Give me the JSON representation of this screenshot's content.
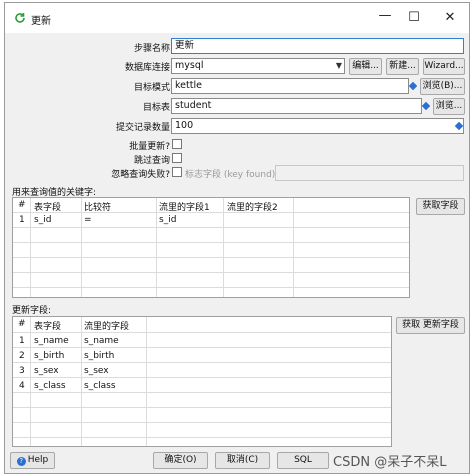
{
  "window": {
    "title": "更新",
    "minimize_glyph": "—",
    "maximize_glyph": "☐",
    "close_glyph": "✕"
  },
  "form": {
    "step_name_label": "步骤名称",
    "step_name_value": "更新",
    "connection_label": "数据库连接",
    "connection_value": "mysql",
    "edit_button": "编辑...",
    "new_button": "新建...",
    "wizard_button": "Wizard...",
    "target_schema_label": "目标模式",
    "target_schema_value": "kettle",
    "browse_schema_button": "浏览(B)...",
    "target_table_label": "目标表",
    "target_table_value": "student",
    "browse_table_button": "浏览...",
    "commit_size_label": "提交记录数量",
    "commit_size_value": "100",
    "batch_update_label": "批量更新?",
    "skip_lookup_label": "跳过查询",
    "ignore_lookup_failure_label": "忽略查询失败?",
    "flag_field_label": "标志字段 (key found)",
    "flag_field_value": ""
  },
  "keys_section": {
    "label": "用来查询值的关键字:",
    "get_fields_button": "获取字段",
    "columns": [
      "#",
      "表字段",
      "比较符",
      "流里的字段1",
      "流里的字段2"
    ],
    "rows": [
      {
        "num": "1",
        "table_field": "s_id",
        "comparator": "=",
        "stream_field1": "s_id",
        "stream_field2": ""
      }
    ]
  },
  "update_section": {
    "label": "更新字段:",
    "get_update_fields_button": "获取 更新字段",
    "columns": [
      "#",
      "表字段",
      "流里的字段"
    ],
    "rows": [
      {
        "num": "1",
        "table_field": "s_name",
        "stream_field": "s_name"
      },
      {
        "num": "2",
        "table_field": "s_birth",
        "stream_field": "s_birth"
      },
      {
        "num": "3",
        "table_field": "s_sex",
        "stream_field": "s_sex"
      },
      {
        "num": "4",
        "table_field": "s_class",
        "stream_field": "s_class"
      }
    ]
  },
  "footer": {
    "help_button": "Help",
    "ok_button": "确定(O)",
    "cancel_button": "取消(C)",
    "sql_button": "SQL"
  },
  "watermark": "CSDN @呆子不呆L",
  "colors": {
    "accent": "#2a6fd1",
    "focus_border": "#2f7fd6",
    "dialog_bg": "#f0f0f0"
  }
}
